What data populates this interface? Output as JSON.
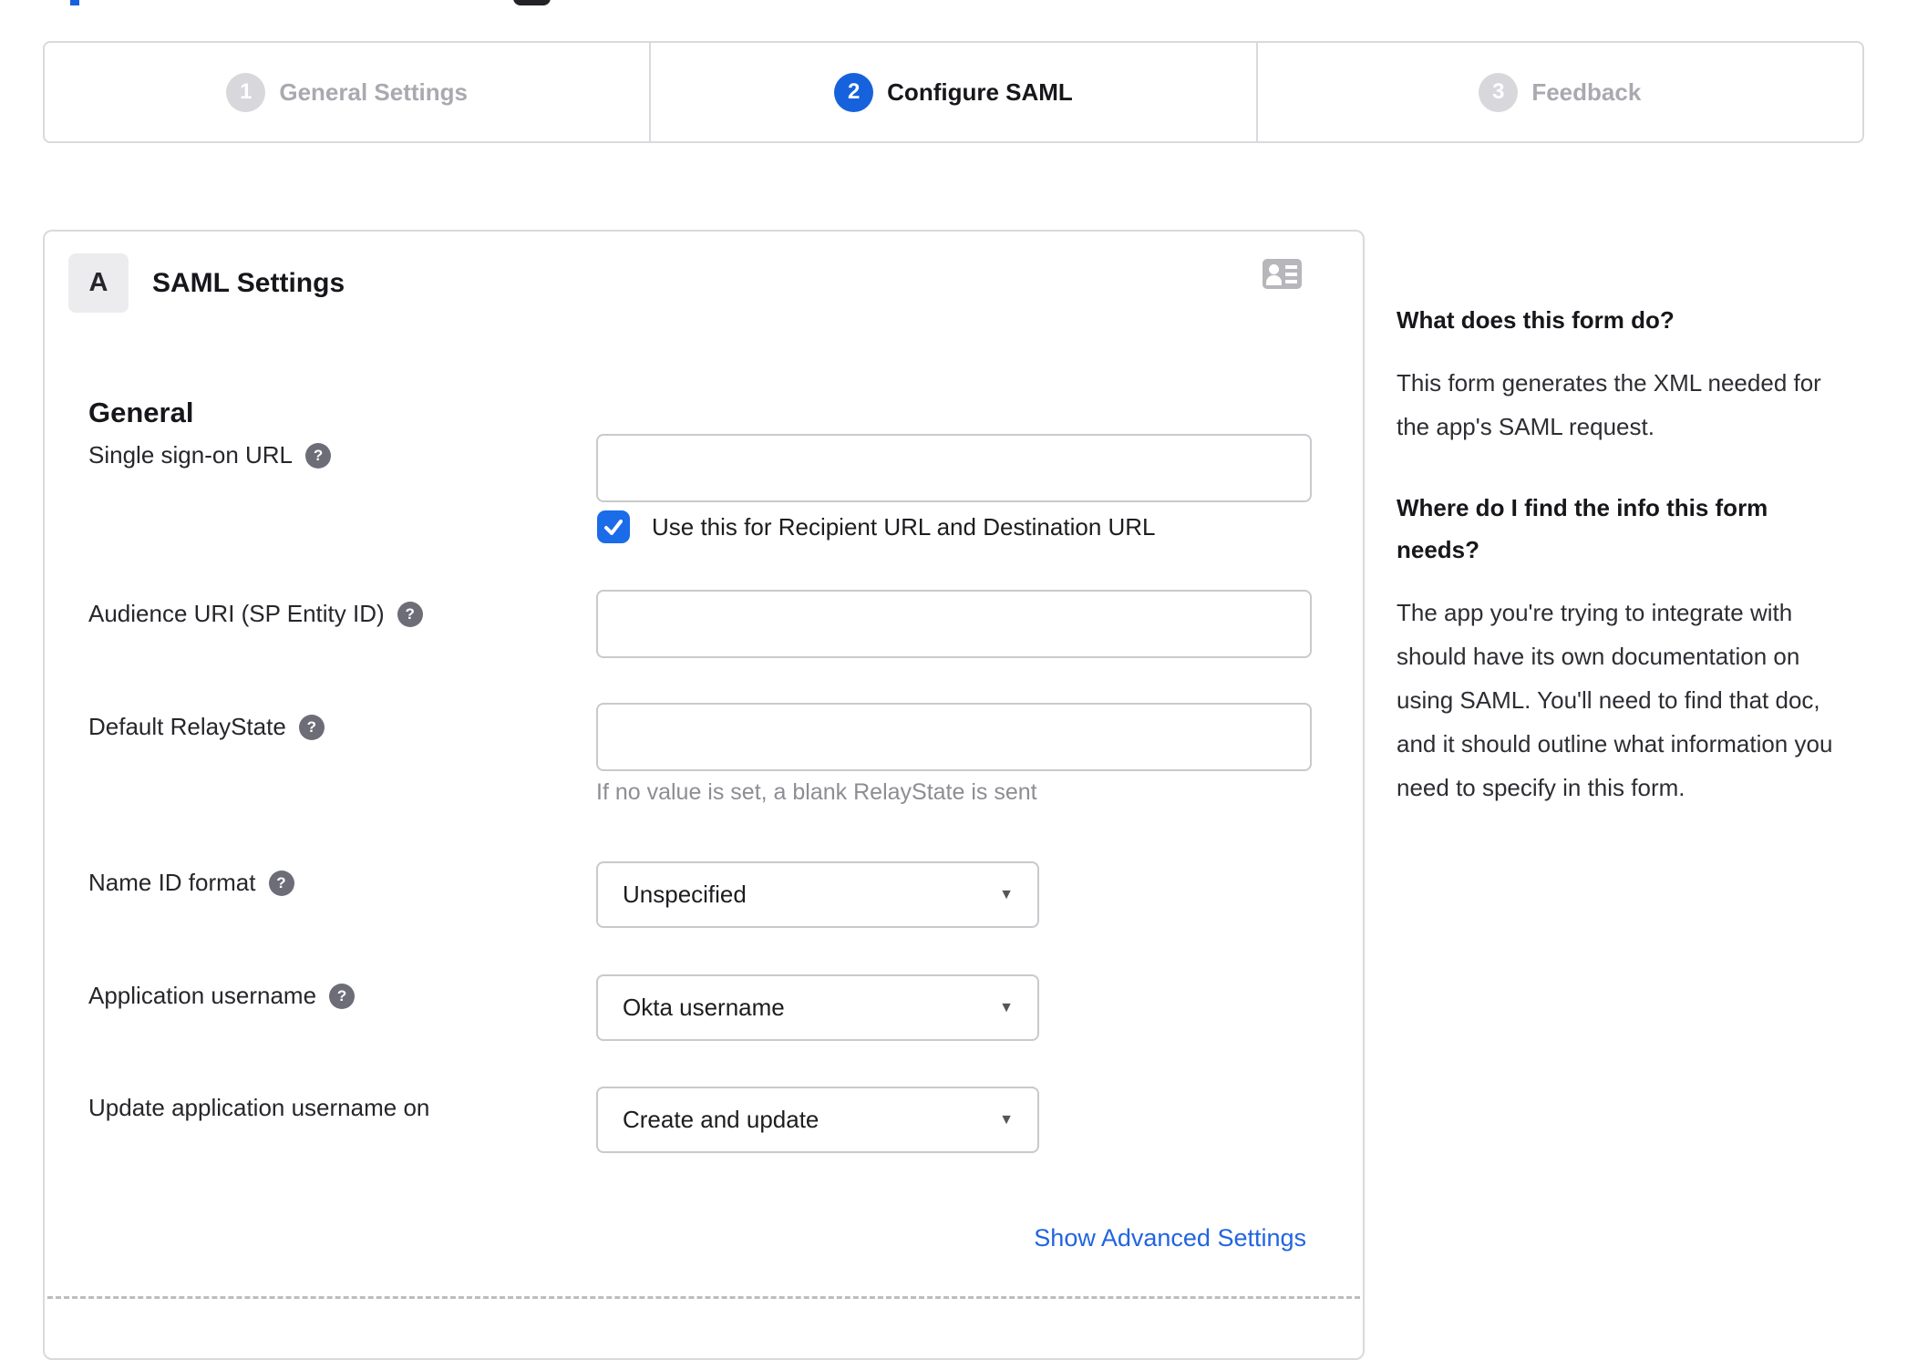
{
  "stepper": {
    "steps": [
      {
        "number": "1",
        "label": "General Settings",
        "state": "inactive"
      },
      {
        "number": "2",
        "label": "Configure SAML",
        "state": "active"
      },
      {
        "number": "3",
        "label": "Feedback",
        "state": "inactive"
      }
    ]
  },
  "panel": {
    "badge": "A",
    "title": "SAML Settings",
    "section_heading": "General",
    "advanced_link": "Show Advanced Settings"
  },
  "form": {
    "fields": [
      {
        "label": "Single sign-on URL",
        "type": "text",
        "value": "",
        "checkbox": {
          "checked": true,
          "label": "Use this for Recipient URL and Destination URL"
        }
      },
      {
        "label": "Audience URI (SP Entity ID)",
        "type": "text",
        "value": ""
      },
      {
        "label": "Default RelayState",
        "type": "text",
        "value": "",
        "hint": "If no value is set, a blank RelayState is sent"
      },
      {
        "label": "Name ID format",
        "type": "select",
        "value": "Unspecified"
      },
      {
        "label": "Application username",
        "type": "select",
        "value": "Okta username"
      },
      {
        "label": "Update application username on",
        "type": "select",
        "value": "Create and update"
      }
    ]
  },
  "sidebar": {
    "sections": [
      {
        "heading": "What does this form do?",
        "body": "This form generates the XML needed for the app's SAML request."
      },
      {
        "heading": "Where do I find the info this form needs?",
        "body": "The app you're trying to integrate with should have its own documentation on using SAML. You'll need to find that doc, and it should outline what information you need to specify in this form."
      }
    ]
  },
  "icons": {
    "help_glyph": "?",
    "caret": "▼"
  },
  "colors": {
    "accent_blue": "#1662dd",
    "checkbox_blue": "#1a6ce8",
    "link_blue": "#2264e0",
    "border_gray": "#d9d9de",
    "input_border": "#c9c9ce",
    "muted_text": "#8d8d93",
    "inactive_step": "#d8d8dc"
  }
}
